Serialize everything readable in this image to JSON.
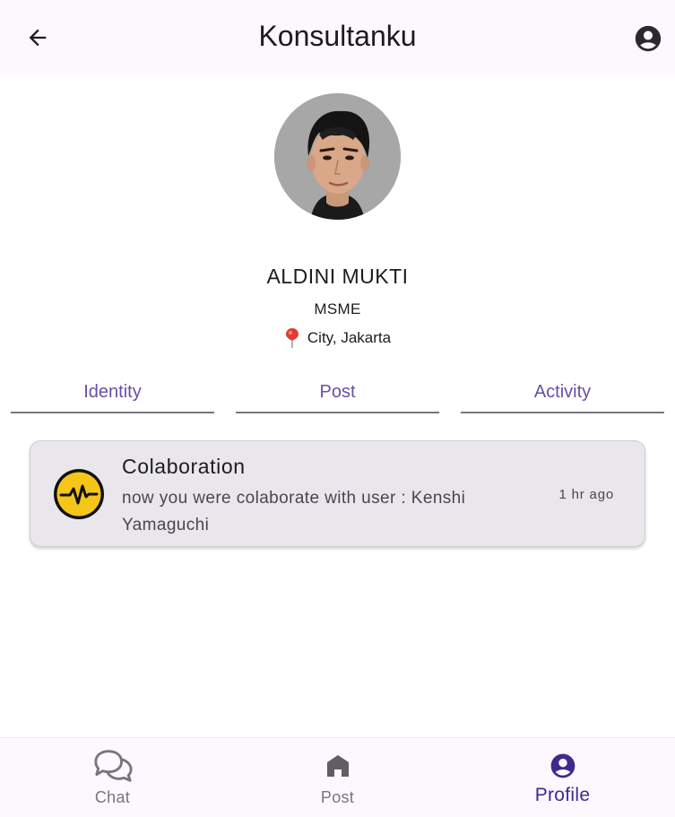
{
  "app_bar": {
    "title": "Konsultanku",
    "back_icon": "arrow-back-icon",
    "account_icon": "account-circle-icon"
  },
  "profile": {
    "name": "ALDINI MUKTI",
    "role": "MSME",
    "location": "City, Jakarta",
    "location_icon": "location-pin-icon"
  },
  "tabs": [
    {
      "label": "Identity"
    },
    {
      "label": "Post"
    },
    {
      "label": "Activity"
    }
  ],
  "activity": [
    {
      "title": "Colaboration",
      "body": "now you were colaborate with user : Kenshi Yamaguchi",
      "time": "1 hr ago",
      "icon": "activity-pulse-icon"
    }
  ],
  "bottom_nav": {
    "items": [
      {
        "label": "Chat",
        "icon": "chat-bubbles-icon"
      },
      {
        "label": "Post",
        "icon": "home-icon"
      },
      {
        "label": "Profile",
        "icon": "account-circle-icon",
        "active": true
      }
    ]
  },
  "colors": {
    "accent": "#6750a4",
    "active_nav": "#3f2a8c",
    "card_background": "#e9e7ec",
    "pulse_icon": "#f5c518",
    "pin": "#e53935"
  }
}
